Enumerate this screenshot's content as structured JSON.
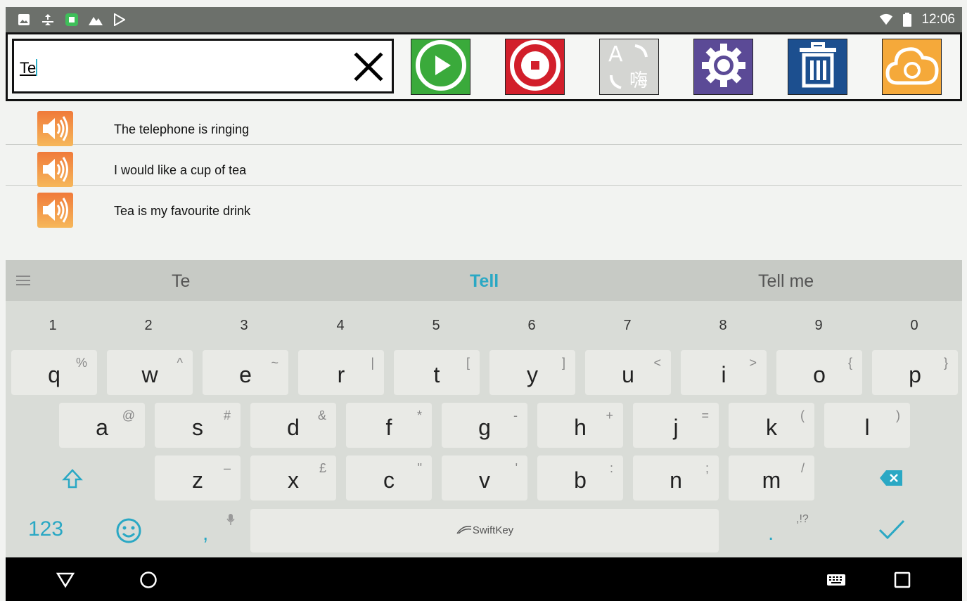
{
  "status_bar": {
    "icons": [
      "image-icon",
      "nav-arrows-icon",
      "app-icon",
      "mountain-icon",
      "play-store-icon"
    ],
    "right_icons": [
      "wifi-icon",
      "battery-icon"
    ],
    "time": "12:06"
  },
  "toolbar": {
    "search": {
      "value": "Te",
      "clear_icon": "close-icon"
    },
    "buttons": [
      {
        "name": "play-button",
        "icon": "play-icon",
        "color": "#3aaa3b"
      },
      {
        "name": "stop-button",
        "icon": "stop-icon",
        "color": "#d21f2b"
      },
      {
        "name": "translate-button",
        "icon": "translate-icon",
        "color": "#d4d5d2",
        "glyph_latin": "A",
        "glyph_cjk": "嗨"
      },
      {
        "name": "settings-button",
        "icon": "gear-icon",
        "color": "#5b4a96"
      },
      {
        "name": "delete-button",
        "icon": "trash-icon",
        "color": "#1c4f8f"
      },
      {
        "name": "sync-button",
        "icon": "cloud-sync-icon",
        "color": "#f5a93a"
      }
    ]
  },
  "phrases": [
    {
      "text": "The telephone is ringing",
      "icon": "speaker-icon"
    },
    {
      "text": "I would like a cup of tea",
      "icon": "speaker-icon"
    },
    {
      "text": "Tea is my favourite drink",
      "icon": "speaker-icon"
    }
  ],
  "keyboard": {
    "suggestions": {
      "left": "Te",
      "center": "Tell",
      "right": "Tell me"
    },
    "numbers": [
      "1",
      "2",
      "3",
      "4",
      "5",
      "6",
      "7",
      "8",
      "9",
      "0"
    ],
    "row1": [
      {
        "key": "q",
        "alt": "%"
      },
      {
        "key": "w",
        "alt": "^"
      },
      {
        "key": "e",
        "alt": "~"
      },
      {
        "key": "r",
        "alt": "|"
      },
      {
        "key": "t",
        "alt": "["
      },
      {
        "key": "y",
        "alt": "]"
      },
      {
        "key": "u",
        "alt": "<"
      },
      {
        "key": "i",
        "alt": ">"
      },
      {
        "key": "o",
        "alt": "{"
      },
      {
        "key": "p",
        "alt": "}"
      }
    ],
    "row2": [
      {
        "key": "a",
        "alt": "@"
      },
      {
        "key": "s",
        "alt": "#"
      },
      {
        "key": "d",
        "alt": "&"
      },
      {
        "key": "f",
        "alt": "*"
      },
      {
        "key": "g",
        "alt": "-"
      },
      {
        "key": "h",
        "alt": "+"
      },
      {
        "key": "j",
        "alt": "="
      },
      {
        "key": "k",
        "alt": "("
      },
      {
        "key": "l",
        "alt": ")"
      }
    ],
    "row3": [
      {
        "key": "z",
        "alt": "–"
      },
      {
        "key": "x",
        "alt": "£"
      },
      {
        "key": "c",
        "alt": "\""
      },
      {
        "key": "v",
        "alt": "'"
      },
      {
        "key": "b",
        "alt": ":"
      },
      {
        "key": "n",
        "alt": ";"
      },
      {
        "key": "m",
        "alt": "/"
      }
    ],
    "bottom": {
      "numbers_label": "123",
      "comma": ",",
      "period": ".",
      "punct_alt": ",!?",
      "space_brand": "SwiftKey"
    },
    "accent_color": "#2aa8c4"
  },
  "nav_bar": {
    "buttons": [
      "back-icon",
      "home-icon",
      "keyboard-icon",
      "recents-icon"
    ]
  }
}
